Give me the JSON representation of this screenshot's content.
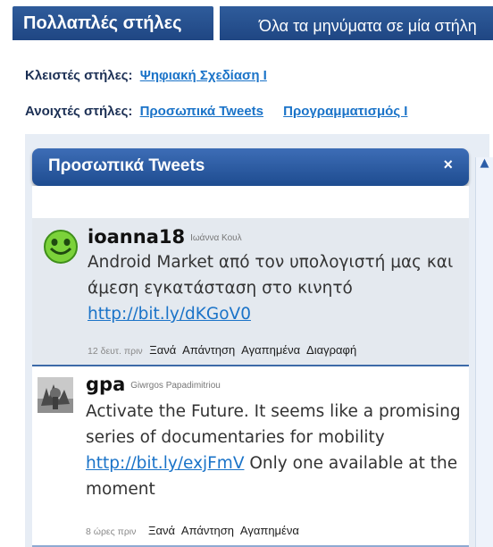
{
  "tabs": {
    "active_label": "Πολλαπλές στήλες",
    "inactive_label": "Όλα τα μηνύματα σε μία στήλη"
  },
  "columns": {
    "closed_label": "Κλειστές στήλες:",
    "closed_items": [
      "Ψηφιακή Σχεδίαση Ι"
    ],
    "open_label": "Ανοιχτές στήλες:",
    "open_items": [
      "Προσωπικά Tweets",
      "Προγραμματισμός Ι"
    ]
  },
  "panel": {
    "title": "Προσωπικά Tweets",
    "close_symbol": "×"
  },
  "tweets": [
    {
      "username": "ioanna18",
      "full_name": "Ιωάννα Κουλ",
      "text_before": "Android Market από τον υπολογιστή μας και άμεση εγκατάσταση στο κινητό ",
      "url": "http://bit.ly/dKGoV0",
      "text_after": "",
      "time": "12 δευτ. πριν",
      "actions": [
        "Ξανά",
        "Απάντηση",
        "Αγαπημένα",
        "Διαγραφή"
      ],
      "avatar_icon": "smiley-avatar-icon"
    },
    {
      "username": "gpa",
      "full_name": "Giwrgos Papadimitriou",
      "text_before": "Activate the Future. It seems like a promising series of documentaries for mobility ",
      "url": "http://bit.ly/exjFmV",
      "text_after": " Only one available at the moment",
      "time": "8 ώρες πριν",
      "actions": [
        "Ξανά",
        "Απάντηση",
        "Αγαπημένα"
      ],
      "avatar_icon": "photo-avatar-icon"
    }
  ],
  "colors": {
    "tab_blue": "#1f4683",
    "link_blue": "#1a73c8",
    "panel_header": "#2a5aa0",
    "tweet_highlight": "#e4e9ef"
  }
}
